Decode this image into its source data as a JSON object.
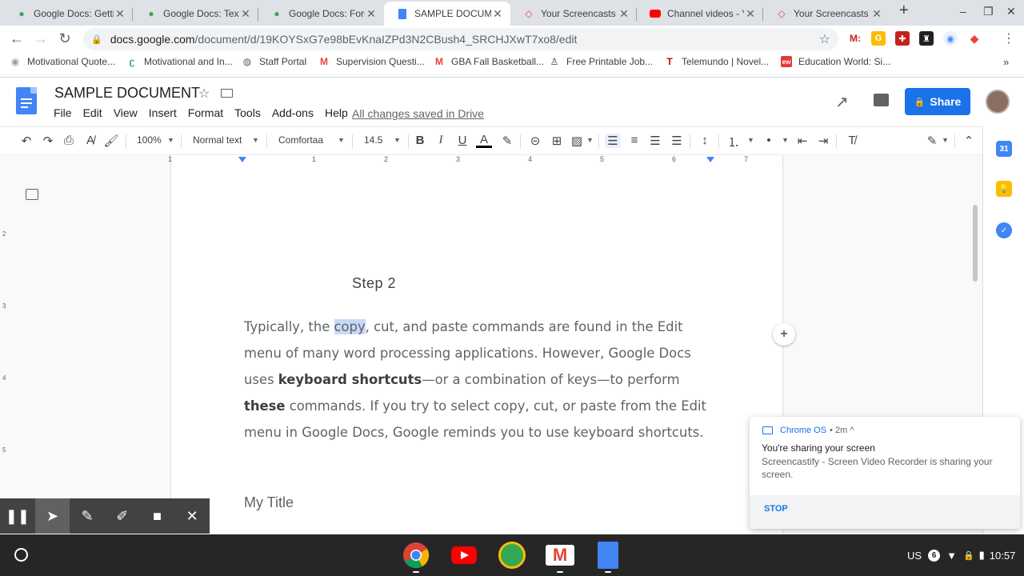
{
  "browser": {
    "tabs": [
      {
        "title": "Google Docs: Getti",
        "icon_color": "#34a853",
        "icon": "gcf-icon"
      },
      {
        "title": "Google Docs: Text f",
        "icon_color": "#34a853",
        "icon": "gcf-icon"
      },
      {
        "title": "Google Docs: Form",
        "icon_color": "#34a853",
        "icon": "gcf-icon"
      },
      {
        "title": "SAMPLE DOCUMEN",
        "icon_color": "#4285f4",
        "icon": "docs-icon",
        "active": true
      },
      {
        "title": "Your Screencasts -",
        "icon_color": "#ea4335",
        "icon": "screencastify-icon"
      },
      {
        "title": "Channel videos - Yo",
        "icon_color": "#ff0000",
        "icon": "youtube-icon"
      },
      {
        "title": "Your Screencasts -",
        "icon_color": "#ea4335",
        "icon": "screencastify-icon"
      }
    ],
    "url_host": "docs.google.com",
    "url_path": "/document/d/19KOYSxG7e98bEvKnaIZPd3N2CBush4_SRCHJXwT7xo8/edit",
    "bookmarks": [
      {
        "label": "Motivational Quote...",
        "icon": "bookmark-icon"
      },
      {
        "label": "Motivational and In...",
        "icon": "bookmark-icon"
      },
      {
        "label": "Staff Portal",
        "icon": "globe-icon"
      },
      {
        "label": "Supervision Questi...",
        "icon": "gmail-icon"
      },
      {
        "label": "GBA Fall Basketball...",
        "icon": "gmail-icon"
      },
      {
        "label": "Free Printable Job...",
        "icon": "bookmark-icon"
      },
      {
        "label": "Telemundo | Novel...",
        "icon": "telemundo-icon"
      },
      {
        "label": "Education World: Si...",
        "icon": "ew-icon"
      }
    ]
  },
  "docs": {
    "title": "SAMPLE DOCUMENT",
    "menu": [
      "File",
      "Edit",
      "View",
      "Insert",
      "Format",
      "Tools",
      "Add-ons",
      "Help"
    ],
    "saved_status": "All changes saved in Drive",
    "share_label": "Share",
    "toolbar": {
      "zoom": "100%",
      "style": "Normal text",
      "font": "Comfortaa",
      "size": "14.5"
    },
    "ruler_numbers": [
      "1",
      "1",
      "2",
      "3",
      "4",
      "5",
      "6",
      "7"
    ],
    "vruler_numbers": [
      "2",
      "3",
      "4",
      "5"
    ]
  },
  "document": {
    "heading": "Step 2",
    "p_a": "Typically, the ",
    "p_sel": "copy",
    "p_b": ", cut, and paste commands are found in the Edit menu of many word processing applications. However, Google Docs uses ",
    "p_bold1": "keyboard shortcuts",
    "p_c": "—or a combination of keys—to perform ",
    "p_bold2": "these",
    "p_d": " commands. If you try to select copy, cut, or paste from the Edit menu in Google Docs, Google reminds you to use keyboard shortcuts.",
    "my_title": "My Title"
  },
  "notification": {
    "source": "Chrome OS",
    "meta": "• 2m ^",
    "title": "You're sharing your screen",
    "body": "Screencastify - Screen Video Recorder is sharing your screen.",
    "action": "STOP"
  },
  "shelf": {
    "locale": "US",
    "badge": "6",
    "time": "10:57"
  },
  "colors": {
    "accent": "#1a73e8",
    "docs_blue": "#4285f4",
    "selection": "#c8d9f7"
  }
}
